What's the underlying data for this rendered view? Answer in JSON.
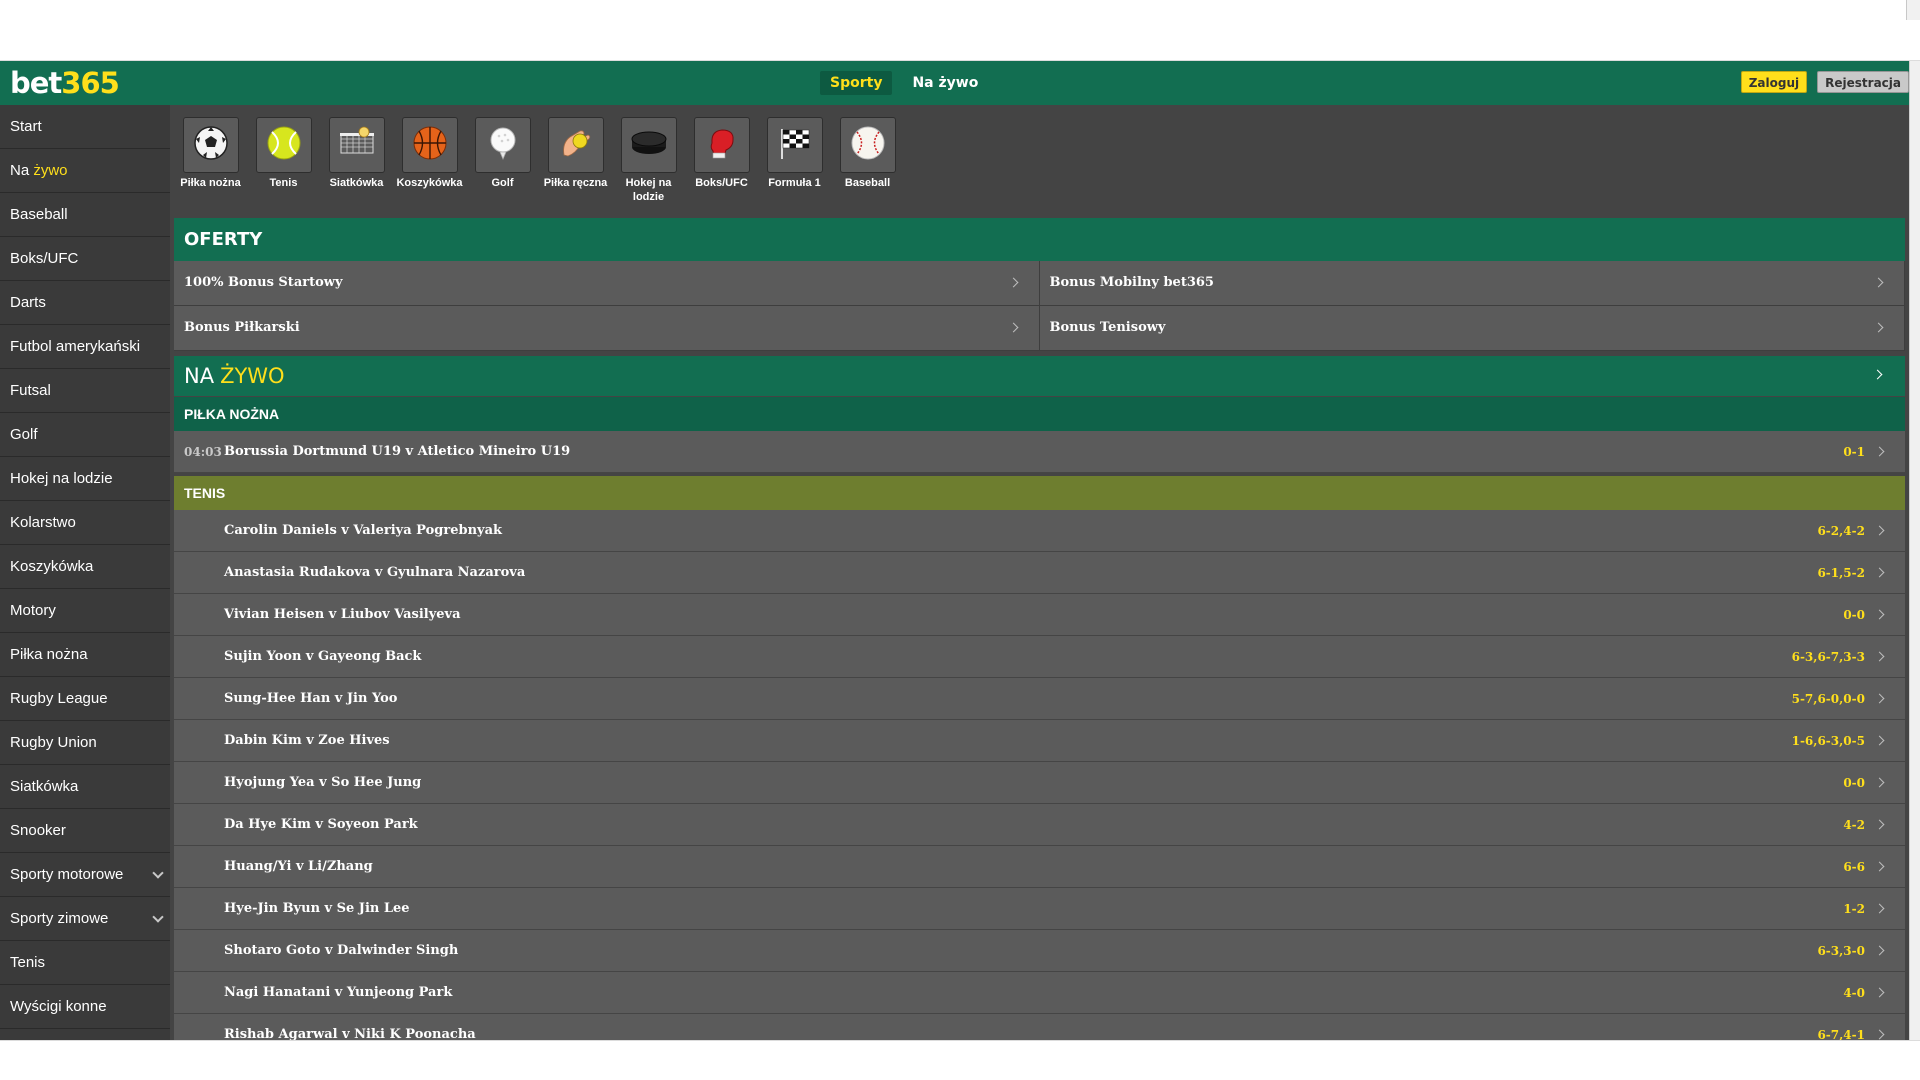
{
  "header": {
    "logo_text": "bet",
    "logo_num": "365",
    "nav": [
      {
        "label": "Sporty",
        "active": true
      },
      {
        "label": "Na żywo",
        "active": false
      }
    ],
    "login_label": "Zaloguj",
    "register_label": "Rejestracja"
  },
  "colors": {
    "brand_green": "#126e51",
    "accent_yellow": "#ffdf1b",
    "panel_grey": "#5b5b5b",
    "tennis_band": "#6e7e2f"
  },
  "sidebar": {
    "items": [
      {
        "label": "Start",
        "pre": "",
        "hl": ""
      },
      {
        "label": "",
        "pre": "Na ",
        "hl": "żywo"
      },
      {
        "label": "Baseball",
        "pre": "",
        "hl": ""
      },
      {
        "label": "Boks/UFC",
        "pre": "",
        "hl": ""
      },
      {
        "label": "Darts",
        "pre": "",
        "hl": ""
      },
      {
        "label": "Futbol amerykański",
        "pre": "",
        "hl": ""
      },
      {
        "label": "Futsal",
        "pre": "",
        "hl": ""
      },
      {
        "label": "Golf",
        "pre": "",
        "hl": ""
      },
      {
        "label": "Hokej na lodzie",
        "pre": "",
        "hl": ""
      },
      {
        "label": "Kolarstwo",
        "pre": "",
        "hl": ""
      },
      {
        "label": "Koszykówka",
        "pre": "",
        "hl": ""
      },
      {
        "label": "Motory",
        "pre": "",
        "hl": ""
      },
      {
        "label": "Piłka nożna",
        "pre": "",
        "hl": ""
      },
      {
        "label": "Rugby League",
        "pre": "",
        "hl": ""
      },
      {
        "label": "Rugby Union",
        "pre": "",
        "hl": ""
      },
      {
        "label": "Siatkówka",
        "pre": "",
        "hl": ""
      },
      {
        "label": "Snooker",
        "pre": "",
        "hl": ""
      },
      {
        "label": "Sporty motorowe",
        "pre": "",
        "hl": "",
        "expandable": true
      },
      {
        "label": "Sporty zimowe",
        "pre": "",
        "hl": "",
        "expandable": true
      },
      {
        "label": "Tenis",
        "pre": "",
        "hl": ""
      },
      {
        "label": "Wyścigi konne",
        "pre": "",
        "hl": ""
      }
    ]
  },
  "sports_bar": [
    {
      "label": "Piłka nożna",
      "icon": "soccer-ball-icon"
    },
    {
      "label": "Tenis",
      "icon": "tennis-ball-icon"
    },
    {
      "label": "Siatkówka",
      "icon": "volleyball-net-icon"
    },
    {
      "label": "Koszykówka",
      "icon": "basketball-icon"
    },
    {
      "label": "Golf",
      "icon": "golf-ball-icon"
    },
    {
      "label": "Piłka ręczna",
      "icon": "handball-icon"
    },
    {
      "label": "Hokej na lodzie",
      "icon": "hockey-puck-icon"
    },
    {
      "label": "Boks/UFC",
      "icon": "boxing-glove-icon"
    },
    {
      "label": "Formuła 1",
      "icon": "checkered-flag-icon"
    },
    {
      "label": "Baseball",
      "icon": "baseball-icon"
    }
  ],
  "offers": {
    "title": "OFERTY",
    "items": [
      "100% Bonus Startowy",
      "Bonus Mobilny bet365",
      "Bonus Piłkarski",
      "Bonus Tenisowy"
    ]
  },
  "live": {
    "title_pre": "NA",
    "title_hl": "ŻYWO",
    "football": {
      "title": "PIŁKA NOŻNA",
      "matches": [
        {
          "time": "04:03",
          "name": "Borussia Dortmund U19 v Atletico Mineiro U19",
          "score": "0-1"
        }
      ]
    },
    "tennis": {
      "title": "TENIS",
      "matches": [
        {
          "name": "Carolin Daniels v Valeriya Pogrebnyak",
          "score": "6-2,4-2"
        },
        {
          "name": "Anastasia Rudakova v Gyulnara Nazarova",
          "score": "6-1,5-2"
        },
        {
          "name": "Vivian Heisen v Liubov Vasilyeva",
          "score": "0-0"
        },
        {
          "name": "Sujin Yoon v Gayeong Back",
          "score": "6-3,6-7,3-3"
        },
        {
          "name": "Sung-Hee Han v Jin Yoo",
          "score": "5-7,6-0,0-0"
        },
        {
          "name": "Dabin Kim v Zoe Hives",
          "score": "1-6,6-3,0-5"
        },
        {
          "name": "Hyojung Yea v So Hee Jung",
          "score": "0-0"
        },
        {
          "name": "Da Hye Kim v Soyeon Park",
          "score": "4-2"
        },
        {
          "name": "Huang/Yi v Li/Zhang",
          "score": "6-6"
        },
        {
          "name": "Hye-Jin Byun v Se Jin Lee",
          "score": "1-2"
        },
        {
          "name": "Shotaro Goto v Dalwinder Singh",
          "score": "6-3,3-0"
        },
        {
          "name": "Nagi Hanatani v Yunjeong Park",
          "score": "4-0"
        },
        {
          "name": "Rishab Agarwal v Niki K Poonacha",
          "score": "6-7,4-1"
        }
      ]
    }
  }
}
